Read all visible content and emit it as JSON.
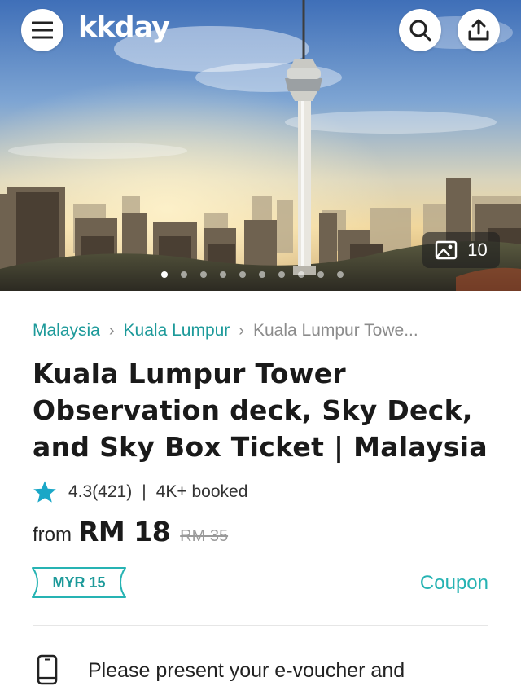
{
  "header": {
    "logo": "kkday",
    "menu_icon": "hamburger-menu-icon",
    "search_icon": "search-icon",
    "share_icon": "share-upload-icon"
  },
  "gallery": {
    "photo_count": "10",
    "icon": "image-icon",
    "slide_total": 10,
    "active_slide": 1
  },
  "breadcrumb": {
    "items": [
      "Malaysia",
      "Kuala Lumpur",
      "Kuala Lumpur Towe..."
    ]
  },
  "product": {
    "title": "Kuala Lumpur Tower Observation deck, Sky Deck, and Sky Box Ticket | Malaysia",
    "rating": "4.3(421)",
    "booked": "4K+ booked",
    "price_prefix": "from",
    "price": "RM 18",
    "original_price": "RM 35"
  },
  "coupon": {
    "tag": "MYR 15",
    "link": "Coupon"
  },
  "info": {
    "icon": "phone-icon",
    "text": "Please present your e-voucher and"
  },
  "colors": {
    "brand": "#26b3b3",
    "star": "#1aa7c7"
  }
}
